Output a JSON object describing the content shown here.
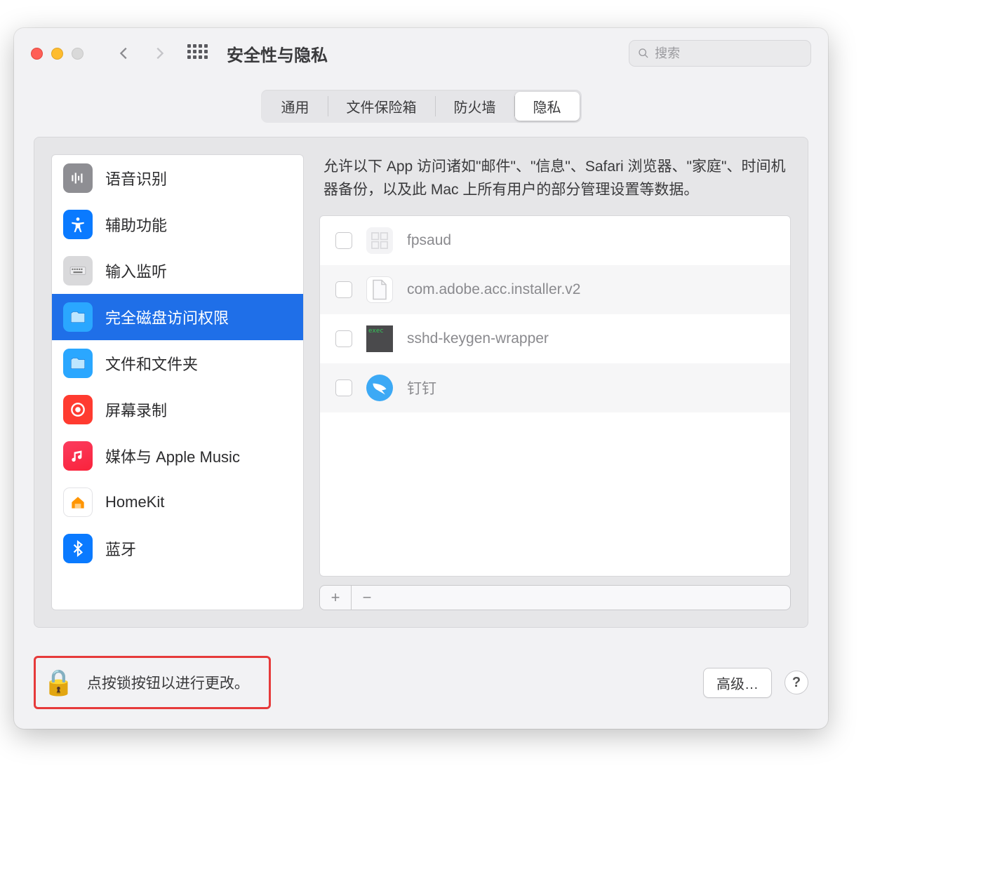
{
  "header": {
    "title": "安全性与隐私",
    "search_placeholder": "搜索"
  },
  "tabs": {
    "general": "通用",
    "filevault": "文件保险箱",
    "firewall": "防火墙",
    "privacy": "隐私"
  },
  "sidebar": {
    "items": [
      {
        "label": "语音识别",
        "icon": "speech"
      },
      {
        "label": "辅助功能",
        "icon": "accessibility"
      },
      {
        "label": "输入监听",
        "icon": "keyboard"
      },
      {
        "label": "完全磁盘访问权限",
        "icon": "folder",
        "selected": true
      },
      {
        "label": "文件和文件夹",
        "icon": "folder"
      },
      {
        "label": "屏幕录制",
        "icon": "screenrecord"
      },
      {
        "label": "媒体与 Apple Music",
        "icon": "music"
      },
      {
        "label": "HomeKit",
        "icon": "home"
      },
      {
        "label": "蓝牙",
        "icon": "bluetooth"
      }
    ]
  },
  "detail": {
    "description": "允许以下 App 访问诸如\"邮件\"、\"信息\"、Safari 浏览器、\"家庭\"、时间机器备份，以及此 Mac 上所有用户的部分管理设置等数据。",
    "apps": [
      {
        "name": "fpsaud",
        "icon": "generic"
      },
      {
        "name": "com.adobe.acc.installer.v2",
        "icon": "document"
      },
      {
        "name": "sshd-keygen-wrapper",
        "icon": "exec"
      },
      {
        "name": "钉钉",
        "icon": "dingtalk"
      }
    ],
    "add_label": "+",
    "remove_label": "−"
  },
  "footer": {
    "lock_text": "点按锁按钮以进行更改。",
    "advanced_label": "高级…",
    "help_label": "?"
  }
}
